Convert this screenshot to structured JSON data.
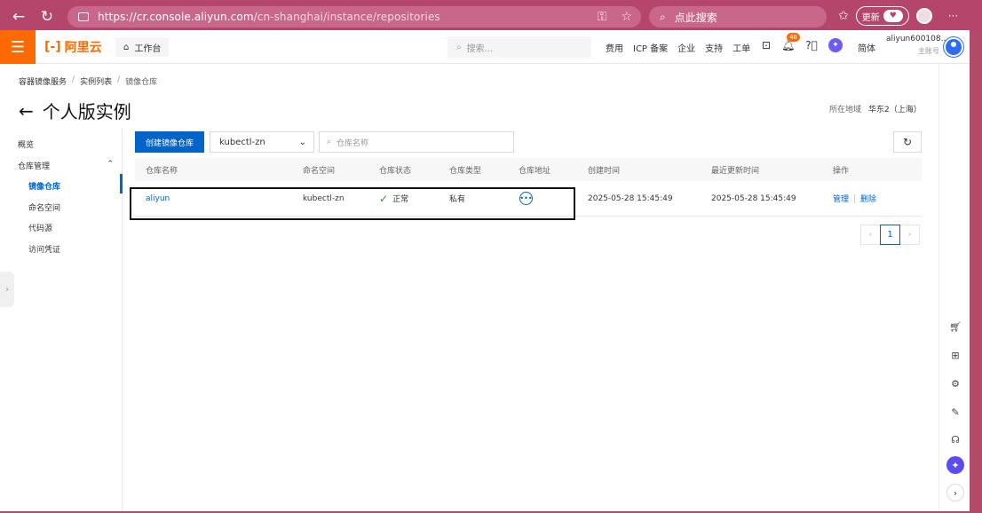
{
  "browser": {
    "url_host": "https://cr.console.aliyun.com",
    "url_path": "/cn-shanghai/instance/repositories",
    "search_text": "点此搜索",
    "update_label": "更新"
  },
  "header": {
    "logo_text": "阿里云",
    "logo_mark": "[-]",
    "workbench_label": "工作台",
    "search_placeholder": "搜索...",
    "links": [
      "费用",
      "ICP 备案",
      "企业",
      "支持",
      "工单"
    ],
    "bell_badge": "48",
    "lang_label": "简体",
    "account_name": "aliyun600108...",
    "account_role": "主账号"
  },
  "breadcrumb": {
    "items": [
      "容器镜像服务",
      "实例列表",
      "镜像仓库"
    ]
  },
  "page": {
    "title": "个人版实例",
    "region_label": "所在地域",
    "region_value": "华东2（上海）"
  },
  "sidebar": {
    "overview": "概览",
    "repo_group": "仓库管理",
    "items": [
      "镜像仓库",
      "命名空间",
      "代码源",
      "访问凭证"
    ]
  },
  "toolbar": {
    "create_label": "创建镜像仓库",
    "namespace_value": "kubectl-zn",
    "search_placeholder": "仓库名称"
  },
  "table": {
    "columns": [
      "仓库名称",
      "命名空间",
      "仓库状态",
      "仓库类型",
      "仓库地址",
      "创建时间",
      "最近更新时间",
      "操作"
    ],
    "rows": [
      {
        "name": "aliyun",
        "namespace": "kubectl-zn",
        "status": "正常",
        "type": "私有",
        "created": "2025-05-28 15:45:49",
        "updated": "2025-05-28 15:45:49",
        "op_manage": "管理",
        "op_delete": "删除"
      }
    ]
  },
  "pagination": {
    "current": "1"
  },
  "colors": {
    "brand_orange": "#ff6a00",
    "primary_blue": "#0064c8",
    "browser_chrome": "#b3466a"
  }
}
